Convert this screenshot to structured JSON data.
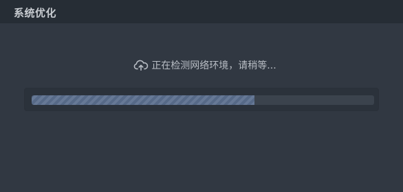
{
  "window": {
    "title": "系统优化"
  },
  "status": {
    "icon": "cloud-upload-icon",
    "text": "正在检测网络环境，请稍等..."
  },
  "progress": {
    "value": 0.65
  },
  "colors": {
    "background": "#313842",
    "titlebar": "#262d35",
    "progress_fill": "#5b6f8e",
    "progress_track": "#3b434d"
  }
}
